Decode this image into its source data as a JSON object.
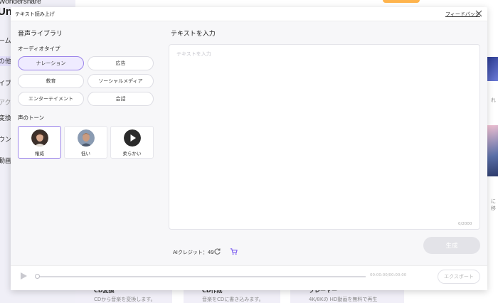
{
  "background": {
    "brand": "Wondershare",
    "logo": "Un",
    "nav": [
      {
        "label": "ーム"
      },
      {
        "label": "の他"
      },
      {
        "label": "イブ"
      },
      {
        "label": "アク"
      },
      {
        "label": "変換"
      },
      {
        "label": "ウン"
      },
      {
        "label": "動画"
      }
    ],
    "cards": [
      {
        "title": "CD変換",
        "desc": "CDから音楽を変換します。"
      },
      {
        "title": "CD作成",
        "desc": "音楽をCDに書き込みます。"
      },
      {
        "title": "プレーヤー",
        "desc": "4K/8Kの HD動画を無料で再生"
      }
    ],
    "side_texts": [
      "れ",
      "に移"
    ]
  },
  "dialog": {
    "title": "テキスト読み上げ",
    "feedback": "フィードバック",
    "library_title": "音声ライブラリ",
    "audio_type_label": "オーディオタイプ",
    "audio_types": [
      {
        "label": "ナレーション",
        "selected": true
      },
      {
        "label": "広告",
        "selected": false
      },
      {
        "label": "教育",
        "selected": false
      },
      {
        "label": "ソーシャルメディア",
        "selected": false
      },
      {
        "label": "エンターテイメント",
        "selected": false
      },
      {
        "label": "会話",
        "selected": false
      }
    ],
    "tone_label": "声のトーン",
    "tones": [
      {
        "label": "権威",
        "selected": true,
        "avatar": "woman-avatar"
      },
      {
        "label": "低い",
        "selected": false,
        "avatar": "man-avatar"
      },
      {
        "label": "柔らかい",
        "selected": false,
        "avatar": "play-avatar"
      }
    ],
    "input_title": "テキストを入力",
    "input_placeholder": "テキストを入力",
    "input_value": "",
    "char_count": "0/2000",
    "credit_text": "AIクレジット：49",
    "generate_label": "生成",
    "time_text": "00:00:00/00:00:00",
    "export_label": "エクスポート"
  },
  "colors": {
    "accent": "#9d86ea",
    "accent_light": "#efebff",
    "cart": "#7b5cf0"
  }
}
